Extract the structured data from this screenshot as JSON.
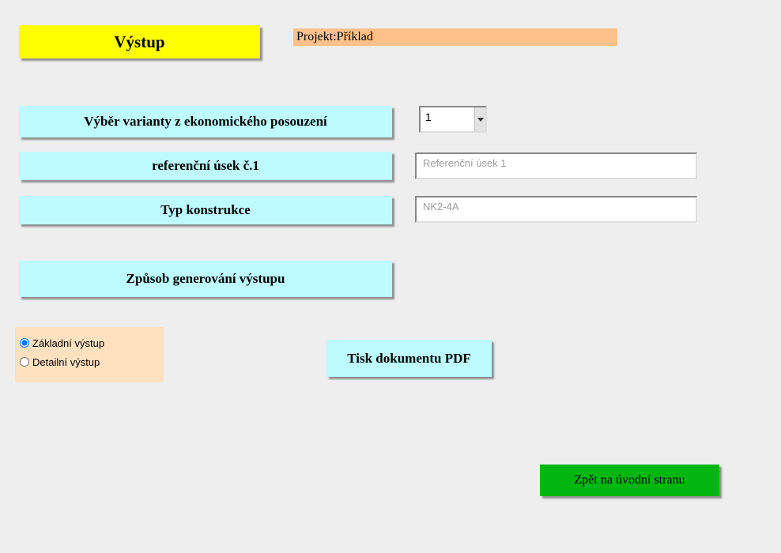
{
  "header": {
    "title": "Výstup"
  },
  "project": {
    "label": "Projekt:",
    "name": "Příklad"
  },
  "labels": {
    "variant_selection": "Výběr varianty z ekonomického posouzení",
    "reference_section": "referenční úsek č.1",
    "construction_type": "Typ konstrukce",
    "generation_mode": "Způsob generování výstupu"
  },
  "variant_select": {
    "value": "1"
  },
  "fields": {
    "reference_section_value": "Referenční úsek 1",
    "construction_type_value": "NK2-4A"
  },
  "radio_options": {
    "basic": "Základní výstup",
    "detailed": "Detailní výstup"
  },
  "buttons": {
    "print_pdf": "Tisk dokumentu PDF",
    "back_home": "Zpět na úvodní stranu"
  }
}
